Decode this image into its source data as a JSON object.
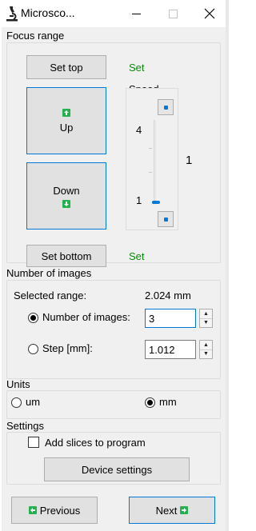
{
  "window": {
    "title": "Microsco...",
    "minimize_glyph": "—",
    "maximize_glyph": "□",
    "close_glyph": "✕",
    "app_icon": "microscope-icon"
  },
  "focus_range": {
    "label": "Focus range",
    "set_top_label": "Set top",
    "set_top_status": "Set",
    "up_label": "Up",
    "down_label": "Down",
    "set_bottom_label": "Set bottom",
    "set_bottom_status": "Set",
    "speed": {
      "label": "Speed",
      "max_tick": "4",
      "min_tick": "1",
      "value": "1",
      "fraction": 0.0
    }
  },
  "number_of_images": {
    "label": "Number of images",
    "selected_range_label": "Selected range:",
    "selected_range_value": "2.024 mm",
    "option_count_label": "Number of images:",
    "count_value": "3",
    "option_step_label": "Step [mm]:",
    "step_value": "1.012",
    "selected_option": "count"
  },
  "units": {
    "label": "Units",
    "option_um": "um",
    "option_mm": "mm",
    "selected": "mm"
  },
  "settings": {
    "label": "Settings",
    "add_slices_label": "Add slices to program",
    "add_slices_checked": false,
    "device_settings_label": "Device settings"
  },
  "nav": {
    "previous_label": "Previous",
    "next_label": "Next"
  },
  "colors": {
    "accent": "#0078d7",
    "success": "#0a8a0a",
    "arrow_green": "#22b14c"
  }
}
